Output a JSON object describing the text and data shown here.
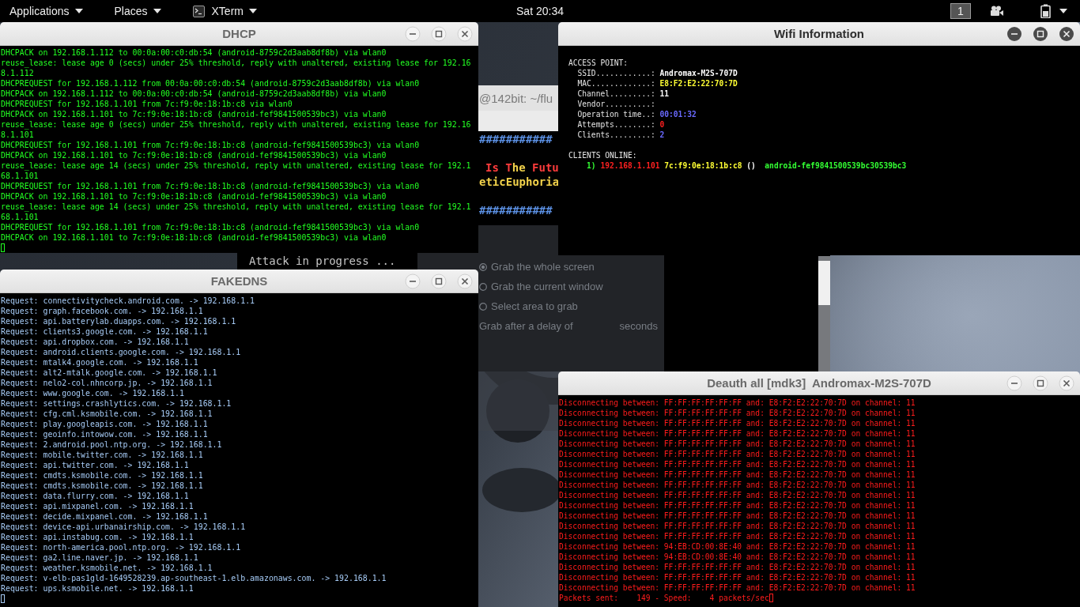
{
  "top_bar": {
    "menus": [
      {
        "label": "Applications",
        "kind": "menu"
      },
      {
        "label": "Places",
        "kind": "menu"
      },
      {
        "label": "XTerm",
        "kind": "app"
      }
    ],
    "clock": "Sat 20:34",
    "workspace": "1"
  },
  "background_terminal": {
    "title": "@142bit: ~/flu",
    "lines": [
      {
        "kind": "hash",
        "text": "###########"
      },
      {
        "kind": "banner",
        "segments": [
          {
            "text": "Is ",
            "color": "#ff3c3c"
          },
          {
            "text": "T",
            "color": "#ff3c3c"
          },
          {
            "text": "he ",
            "color": "#f2d24b"
          },
          {
            "text": "Futu",
            "color": "#ff3c3c"
          }
        ]
      },
      {
        "kind": "text",
        "text": "eticEuphoria"
      },
      {
        "kind": "hash",
        "text": "###########"
      },
      {
        "kind": "status",
        "text": "Attack in progress ..."
      }
    ]
  },
  "screenshot_dialog": {
    "options": [
      {
        "label": "Grab the whole screen",
        "selected": true
      },
      {
        "label": "Grab the current window",
        "selected": false
      },
      {
        "label": "Select area to grab",
        "selected": false
      }
    ],
    "delay_label": "Grab after a delay of",
    "delay_unit": "seconds"
  },
  "windows": [
    {
      "kind": "dhcp",
      "title": "DHCP",
      "focused": false,
      "lines": [
        "DHCPACK on 192.168.1.112 to 00:0a:00:c0:db:54 (android-8759c2d3aab8df8b) via wlan0",
        "reuse_lease: lease age 0 (secs) under 25% threshold, reply with unaltered, existing lease for 192.16",
        "8.1.112",
        "DHCPREQUEST for 192.168.1.112 from 00:0a:00:c0:db:54 (android-8759c2d3aab8df8b) via wlan0",
        "DHCPACK on 192.168.1.112 to 00:0a:00:c0:db:54 (android-8759c2d3aab8df8b) via wlan0",
        "DHCPREQUEST for 192.168.1.101 from 7c:f9:0e:18:1b:c8 via wlan0",
        "DHCPACK on 192.168.1.101 to 7c:f9:0e:18:1b:c8 (android-fef9841500539bc3) via wlan0",
        "reuse_lease: lease age 0 (secs) under 25% threshold, reply with unaltered, existing lease for 192.16",
        "8.1.101",
        "DHCPREQUEST for 192.168.1.101 from 7c:f9:0e:18:1b:c8 (android-fef9841500539bc3) via wlan0",
        "DHCPACK on 192.168.1.101 to 7c:f9:0e:18:1b:c8 (android-fef9841500539bc3) via wlan0",
        "reuse_lease: lease age 14 (secs) under 25% threshold, reply with unaltered, existing lease for 192.1",
        "68.1.101",
        "DHCPREQUEST for 192.168.1.101 from 7c:f9:0e:18:1b:c8 (android-fef9841500539bc3) via wlan0",
        "DHCPACK on 192.168.1.101 to 7c:f9:0e:18:1b:c8 (android-fef9841500539bc3) via wlan0",
        "reuse_lease: lease age 14 (secs) under 25% threshold, reply with unaltered, existing lease for 192.1",
        "68.1.101",
        "DHCPREQUEST for 192.168.1.101 from 7c:f9:0e:18:1b:c8 (android-fef9841500539bc3) via wlan0",
        "DHCPACK on 192.168.1.101 to 7c:f9:0e:18:1b:c8 (android-fef9841500539bc3) via wlan0"
      ]
    },
    {
      "kind": "wifi",
      "title": "Wifi Information",
      "focused": true,
      "sections": [
        {
          "heading": "ACCESS POINT:",
          "fields": [
            {
              "label": "SSID............:",
              "value": "Andromax-M2S-707D",
              "color": "#ffffff"
            },
            {
              "label": "MAC.............:",
              "value": "E8:F2:E2:22:70:7D",
              "color": "#ffff33"
            },
            {
              "label": "Channel.........:",
              "value": "11",
              "color": "#ffffff"
            },
            {
              "label": "Vendor..........:"
            },
            {
              "label": "Operation time..:",
              "value": "00:01:32",
              "color": "#6a6aff"
            },
            {
              "label": "Attempts........:",
              "value": "0",
              "color": "#ff2020"
            },
            {
              "label": "Clients.........:",
              "value": "2",
              "color": "#6a6aff"
            }
          ]
        },
        {
          "heading": "CLIENTS ONLINE:",
          "clients": [
            {
              "segments": [
                {
                  "kind": "index",
                  "text": "1)",
                  "color": "#33ff33"
                },
                {
                  "kind": "ip",
                  "text": "192.168.1.101",
                  "color": "#ff2020"
                },
                {
                  "kind": "mac",
                  "text": "7c:f9:0e:18:1b:c8",
                  "color": "#ffff33"
                },
                {
                  "kind": "vendor",
                  "text": "()",
                  "color": "#ffffff"
                },
                {
                  "kind": "hostname",
                  "text": "android-fef9841500539bc30539bc3",
                  "color": "#33ff33"
                }
              ]
            }
          ]
        }
      ]
    },
    {
      "kind": "fakedns",
      "title": "FAKEDNS",
      "focused": false,
      "lines": [
        "Request: connectivitycheck.android.com. -> 192.168.1.1",
        "Request: graph.facebook.com. -> 192.168.1.1",
        "Request: api.batterylab.duapps.com. -> 192.168.1.1",
        "Request: clients3.google.com. -> 192.168.1.1",
        "Request: api.dropbox.com. -> 192.168.1.1",
        "Request: android.clients.google.com. -> 192.168.1.1",
        "Request: mtalk4.google.com. -> 192.168.1.1",
        "Request: alt2-mtalk.google.com. -> 192.168.1.1",
        "Request: nelo2-col.nhncorp.jp. -> 192.168.1.1",
        "Request: www.google.com. -> 192.168.1.1",
        "Request: settings.crashlytics.com. -> 192.168.1.1",
        "Request: cfg.cml.ksmobile.com. -> 192.168.1.1",
        "Request: play.googleapis.com. -> 192.168.1.1",
        "Request: geoinfo.intowow.com. -> 192.168.1.1",
        "Request: 2.android.pool.ntp.org. -> 192.168.1.1",
        "Request: mobile.twitter.com. -> 192.168.1.1",
        "Request: api.twitter.com. -> 192.168.1.1",
        "Request: cmdts.ksmobile.com. -> 192.168.1.1",
        "Request: cmdts.ksmobile.com. -> 192.168.1.1",
        "Request: data.flurry.com. -> 192.168.1.1",
        "Request: api.mixpanel.com. -> 192.168.1.1",
        "Request: decide.mixpanel.com. -> 192.168.1.1",
        "Request: device-api.urbanairship.com. -> 192.168.1.1",
        "Request: api.instabug.com. -> 192.168.1.1",
        "Request: north-america.pool.ntp.org. -> 192.168.1.1",
        "Request: ga2.line.naver.jp. -> 192.168.1.1",
        "Request: weather.ksmobile.net. -> 192.168.1.1",
        "Request: v-elb-pas1gld-1649528239.ap-southeast-1.elb.amazonaws.com. -> 192.168.1.1",
        "Request: ups.ksmobile.net. -> 192.168.1.1"
      ]
    },
    {
      "kind": "deauth",
      "title": "Deauth all [mdk3]  Andromax-M2S-707D",
      "focused": false,
      "lines": [
        "Disconnecting between: FF:FF:FF:FF:FF:FF and: E8:F2:E2:22:70:7D on channel: 11",
        "Disconnecting between: FF:FF:FF:FF:FF:FF and: E8:F2:E2:22:70:7D on channel: 11",
        "Disconnecting between: FF:FF:FF:FF:FF:FF and: E8:F2:E2:22:70:7D on channel: 11",
        "Disconnecting between: FF:FF:FF:FF:FF:FF and: E8:F2:E2:22:70:7D on channel: 11",
        "Disconnecting between: FF:FF:FF:FF:FF:FF and: E8:F2:E2:22:70:7D on channel: 11",
        "Disconnecting between: FF:FF:FF:FF:FF:FF and: E8:F2:E2:22:70:7D on channel: 11",
        "Disconnecting between: FF:FF:FF:FF:FF:FF and: E8:F2:E2:22:70:7D on channel: 11",
        "Disconnecting between: FF:FF:FF:FF:FF:FF and: E8:F2:E2:22:70:7D on channel: 11",
        "Disconnecting between: FF:FF:FF:FF:FF:FF and: E8:F2:E2:22:70:7D on channel: 11",
        "Disconnecting between: FF:FF:FF:FF:FF:FF and: E8:F2:E2:22:70:7D on channel: 11",
        "Disconnecting between: FF:FF:FF:FF:FF:FF and: E8:F2:E2:22:70:7D on channel: 11",
        "Disconnecting between: FF:FF:FF:FF:FF:FF and: E8:F2:E2:22:70:7D on channel: 11",
        "Disconnecting between: FF:FF:FF:FF:FF:FF and: E8:F2:E2:22:70:7D on channel: 11",
        "Disconnecting between: FF:FF:FF:FF:FF:FF and: E8:F2:E2:22:70:7D on channel: 11",
        "Disconnecting between: 94:EB:CD:00:8E:40 and: E8:F2:E2:22:70:7D on channel: 11",
        "Disconnecting between: 94:EB:CD:00:8E:40 and: E8:F2:E2:22:70:7D on channel: 11",
        "Disconnecting between: FF:FF:FF:FF:FF:FF and: E8:F2:E2:22:70:7D on channel: 11",
        "Disconnecting between: FF:FF:FF:FF:FF:FF and: E8:F2:E2:22:70:7D on channel: 11",
        "Disconnecting between: FF:FF:FF:FF:FF:FF and: E8:F2:E2:22:70:7D on channel: 11",
        "Packets sent:    149 - Speed:    4 packets/sec"
      ]
    }
  ]
}
